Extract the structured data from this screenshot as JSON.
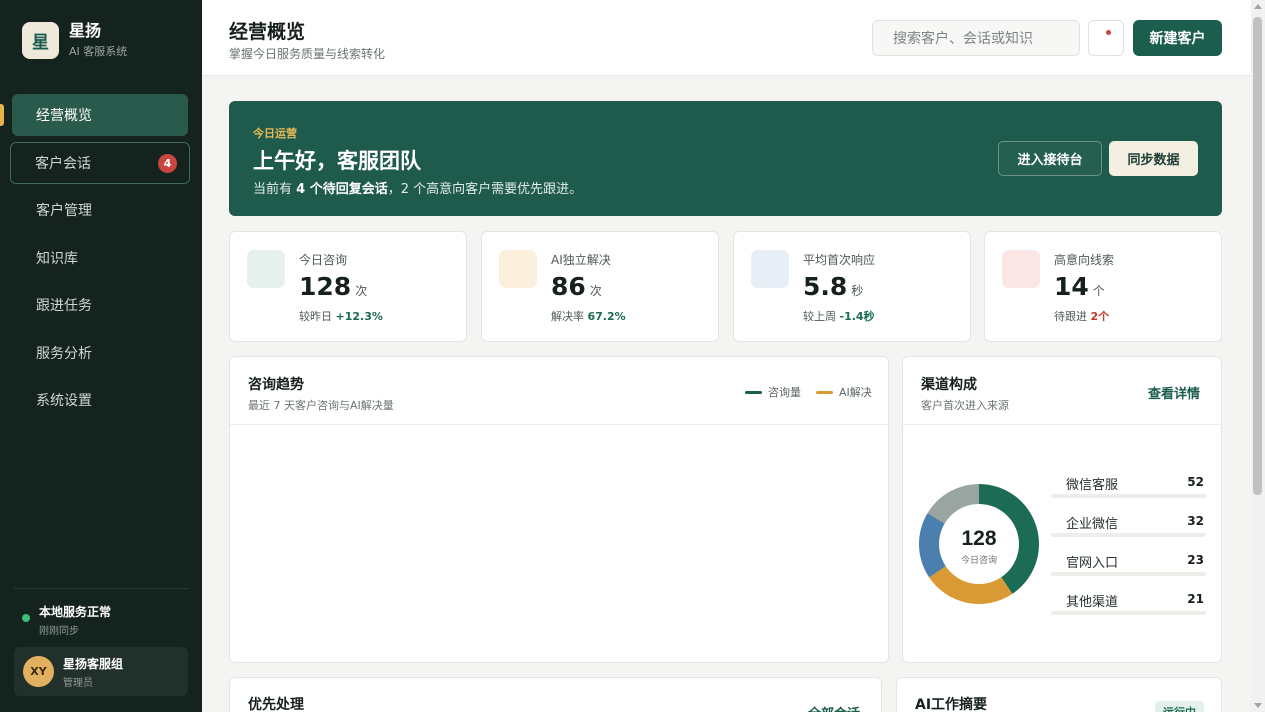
{
  "brand": {
    "logo": "星",
    "name": "星扬",
    "subtitle": "AI 客服系统"
  },
  "nav": [
    {
      "label": "经营概览",
      "active": true
    },
    {
      "label": "客户会话",
      "badge": "4"
    },
    {
      "label": "客户管理"
    },
    {
      "label": "知识库"
    },
    {
      "label": "跟进任务"
    },
    {
      "label": "服务分析"
    },
    {
      "label": "系统设置"
    }
  ],
  "status": {
    "title": "本地服务正常",
    "subtitle": "刚刚同步"
  },
  "user": {
    "initials": "XY",
    "name": "星扬客服组",
    "role": "管理员"
  },
  "header": {
    "title": "经营概览",
    "subtitle": "掌握今日服务质量与线索转化",
    "search_placeholder": "搜索客户、会话或知识",
    "new_button": "新建客户"
  },
  "banner": {
    "kicker": "今日运营",
    "title": "上午好，客服团队",
    "desc_prefix": "当前有",
    "desc_bold": "4 个待回复会话",
    "desc_suffix": "，2 个高意向客户需要优先跟进。",
    "console_button": "进入接待台",
    "sync_button": "同步数据"
  },
  "stats": [
    {
      "label": "今日咨询",
      "value": "128",
      "unit": "次",
      "note_prefix": "较昨日",
      "note_value": "+12.3%",
      "note_tone": "good",
      "icon_color": "#e6f0ec"
    },
    {
      "label": "AI独立解决",
      "value": "86",
      "unit": "次",
      "note_prefix": "解决率",
      "note_value": "67.2%",
      "note_tone": "good",
      "icon_color": "#fbf0dc"
    },
    {
      "label": "平均首次响应",
      "value": "5.8",
      "unit": "秒",
      "note_prefix": "较上周",
      "note_value": "-1.4秒",
      "note_tone": "good",
      "icon_color": "#e7eef6"
    },
    {
      "label": "高意向线索",
      "value": "14",
      "unit": "个",
      "note_prefix": "待跟进",
      "note_value": "2个",
      "note_tone": "bad",
      "icon_color": "#fae6e4"
    }
  ],
  "trend": {
    "title": "咨询趋势",
    "subtitle": "最近 7 天客户咨询与AI解决量",
    "legend": [
      {
        "label": "咨询量",
        "color": "#1b5e4e"
      },
      {
        "label": "AI解决",
        "color": "#d99a36"
      }
    ]
  },
  "channels": {
    "title": "渠道构成",
    "subtitle": "客户首次进入来源",
    "link": "查看详情",
    "center_value": "128",
    "center_label": "今日咨询",
    "items": [
      {
        "name": "微信客服",
        "count": "52",
        "color": "#1b6b55"
      },
      {
        "name": "企业微信",
        "count": "32",
        "color": "#d99a36"
      },
      {
        "name": "官网入口",
        "count": "23",
        "color": "#4b7fae"
      },
      {
        "name": "其他渠道",
        "count": "21",
        "color": "#9aa5a1"
      }
    ]
  },
  "priority": {
    "title": "优先处理",
    "link": "全部会话"
  },
  "ai_summary": {
    "title": "AI工作摘要",
    "badge": "运行中"
  },
  "icons": {
    "notification": "bell-icon",
    "status": "status-dot-icon"
  }
}
